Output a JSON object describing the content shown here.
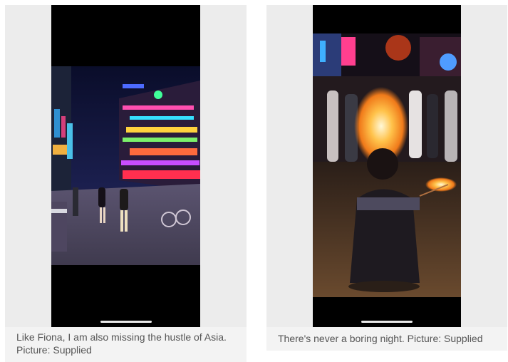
{
  "cards": [
    {
      "caption": "Like Fiona, I am also missing the hustle of Asia. Picture: Supplied",
      "image": "night-street-neon-market"
    },
    {
      "caption": "There's never a boring night. Picture: Supplied",
      "image": "fire-performer-street-night"
    }
  ]
}
